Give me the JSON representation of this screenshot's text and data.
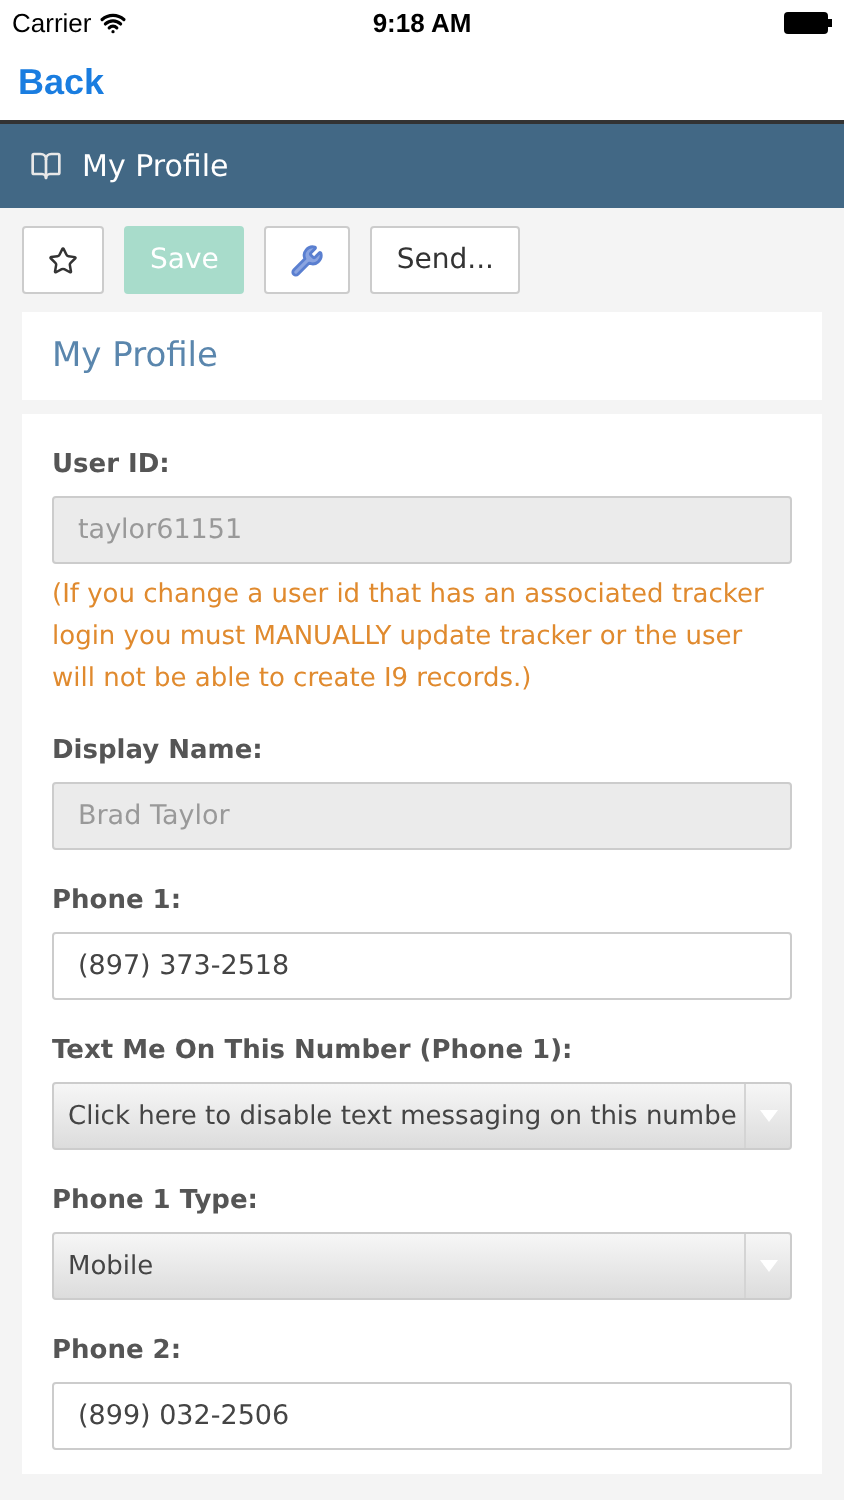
{
  "status_bar": {
    "carrier": "Carrier",
    "time": "9:18 AM"
  },
  "nav": {
    "back": "Back"
  },
  "header": {
    "title": "My Profile"
  },
  "toolbar": [
    {
      "kind": "star",
      "disabled": false
    },
    {
      "kind": "text",
      "label": "Save",
      "disabled": true
    },
    {
      "kind": "wrench",
      "disabled": false
    },
    {
      "kind": "text",
      "label": "Send...",
      "disabled": false
    }
  ],
  "section_title": "My Profile",
  "fields": [
    {
      "kind": "text",
      "label": "User ID:",
      "value": "taylor61151",
      "disabled": true,
      "note": "(If you change a user id that has an associated tracker login you must MANUALLY update tracker or the user will not be able to create I9 records.)"
    },
    {
      "kind": "text",
      "label": "Display Name:",
      "value": "Brad Taylor",
      "disabled": true
    },
    {
      "kind": "text",
      "label": "Phone 1:",
      "value": "(897) 373-2518",
      "disabled": false
    },
    {
      "kind": "select",
      "label": "Text Me On This Number (Phone 1):",
      "value": "Click here to disable text messaging on this numbe"
    },
    {
      "kind": "select",
      "label": "Phone 1 Type:",
      "value": "Mobile"
    },
    {
      "kind": "text",
      "label": "Phone 2:",
      "value": "(899) 032-2506",
      "disabled": false
    }
  ]
}
